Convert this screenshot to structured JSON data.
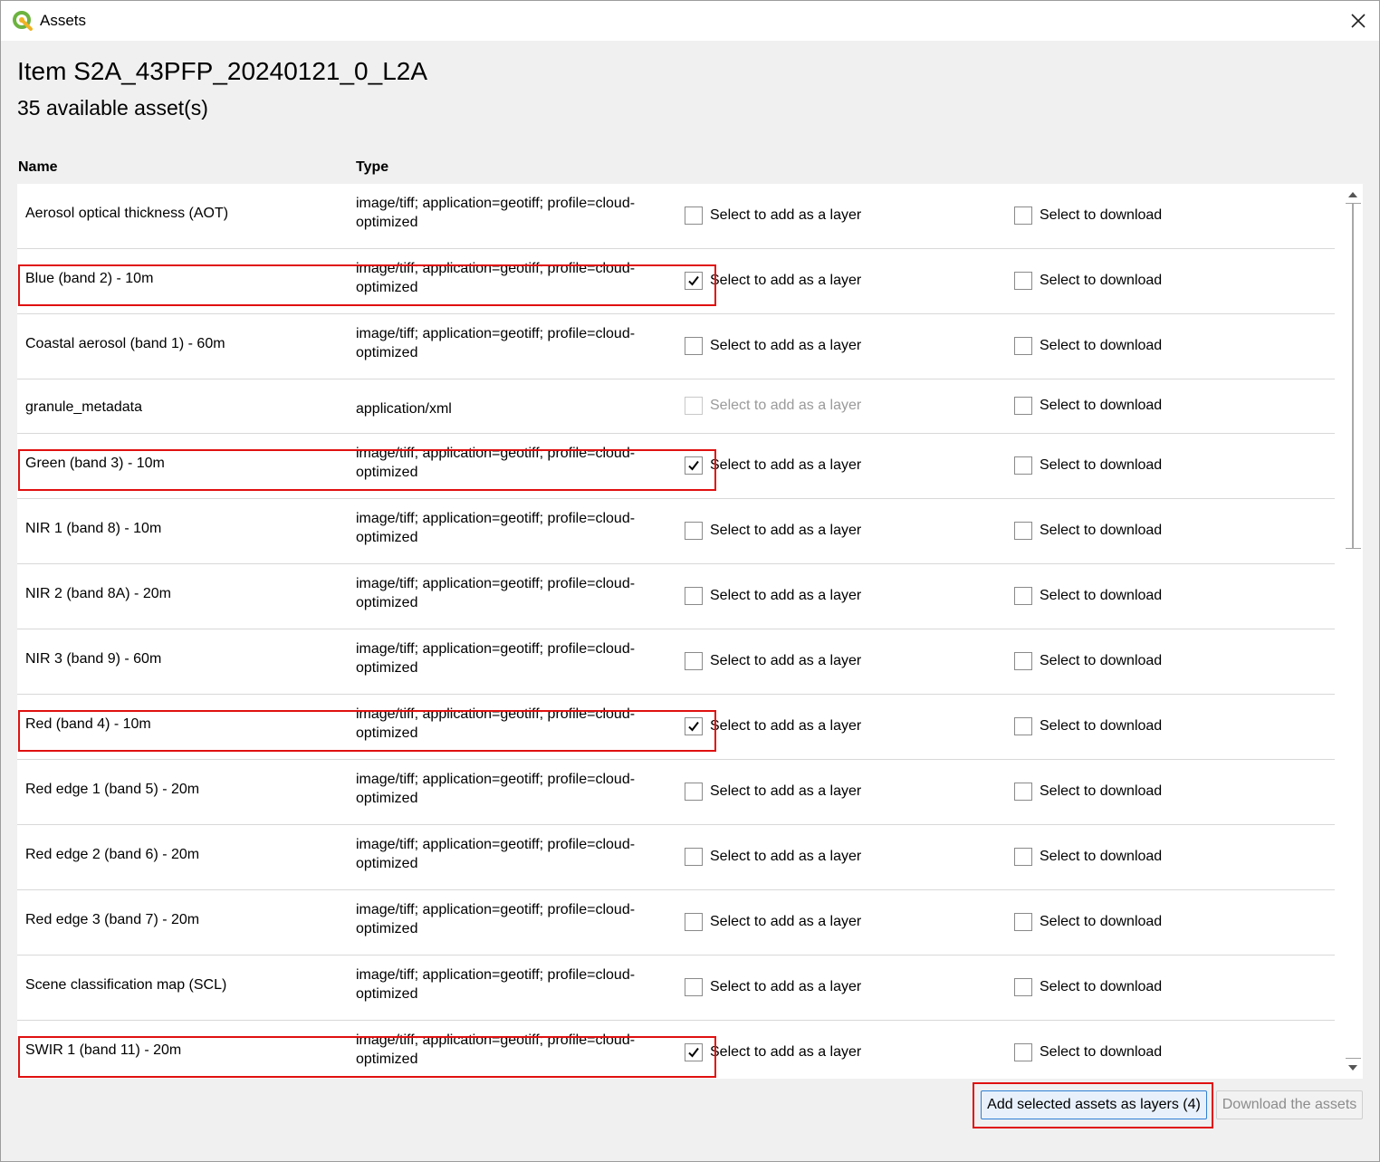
{
  "window": {
    "title": "Assets",
    "icon": "qgis-logo-icon",
    "close_icon": "close-icon"
  },
  "heading": "Item S2A_43PFP_20240121_0_L2A",
  "subheading": "35 available asset(s)",
  "columns": {
    "name": "Name",
    "type": "Type"
  },
  "rows": [
    {
      "name": "Aerosol optical thickness (AOT)",
      "type": "image/tiff; application=geotiff; profile=cloud-optimized",
      "layer_label": "Select to add as a layer",
      "layer_checked": false,
      "layer_enabled": true,
      "download_label": "Select to download",
      "download_checked": false,
      "highlighted": false
    },
    {
      "name": "Blue (band 2) - 10m",
      "type": "image/tiff; application=geotiff; profile=cloud-optimized",
      "layer_label": "Select to add as a layer",
      "layer_checked": true,
      "layer_enabled": true,
      "download_label": "Select to download",
      "download_checked": false,
      "highlighted": true
    },
    {
      "name": "Coastal aerosol (band 1) - 60m",
      "type": "image/tiff; application=geotiff; profile=cloud-optimized",
      "layer_label": "Select to add as a layer",
      "layer_checked": false,
      "layer_enabled": true,
      "download_label": "Select to download",
      "download_checked": false,
      "highlighted": false
    },
    {
      "name": "granule_metadata",
      "type": "application/xml",
      "layer_label": "Select to add as a layer",
      "layer_checked": false,
      "layer_enabled": false,
      "download_label": "Select to download",
      "download_checked": false,
      "highlighted": false
    },
    {
      "name": "Green (band 3) - 10m",
      "type": "image/tiff; application=geotiff; profile=cloud-optimized",
      "layer_label": "Select to add as a layer",
      "layer_checked": true,
      "layer_enabled": true,
      "download_label": "Select to download",
      "download_checked": false,
      "highlighted": true
    },
    {
      "name": "NIR 1 (band 8) - 10m",
      "type": "image/tiff; application=geotiff; profile=cloud-optimized",
      "layer_label": "Select to add as a layer",
      "layer_checked": false,
      "layer_enabled": true,
      "download_label": "Select to download",
      "download_checked": false,
      "highlighted": false
    },
    {
      "name": "NIR 2 (band 8A) - 20m",
      "type": "image/tiff; application=geotiff; profile=cloud-optimized",
      "layer_label": "Select to add as a layer",
      "layer_checked": false,
      "layer_enabled": true,
      "download_label": "Select to download",
      "download_checked": false,
      "highlighted": false
    },
    {
      "name": "NIR 3 (band 9) - 60m",
      "type": "image/tiff; application=geotiff; profile=cloud-optimized",
      "layer_label": "Select to add as a layer",
      "layer_checked": false,
      "layer_enabled": true,
      "download_label": "Select to download",
      "download_checked": false,
      "highlighted": false
    },
    {
      "name": "Red (band 4) - 10m",
      "type": "image/tiff; application=geotiff; profile=cloud-optimized",
      "layer_label": "Select to add as a layer",
      "layer_checked": true,
      "layer_enabled": true,
      "download_label": "Select to download",
      "download_checked": false,
      "highlighted": true
    },
    {
      "name": "Red edge 1 (band 5) - 20m",
      "type": "image/tiff; application=geotiff; profile=cloud-optimized",
      "layer_label": "Select to add as a layer",
      "layer_checked": false,
      "layer_enabled": true,
      "download_label": "Select to download",
      "download_checked": false,
      "highlighted": false
    },
    {
      "name": "Red edge 2 (band 6) - 20m",
      "type": "image/tiff; application=geotiff; profile=cloud-optimized",
      "layer_label": "Select to add as a layer",
      "layer_checked": false,
      "layer_enabled": true,
      "download_label": "Select to download",
      "download_checked": false,
      "highlighted": false
    },
    {
      "name": "Red edge 3 (band 7) - 20m",
      "type": "image/tiff; application=geotiff; profile=cloud-optimized",
      "layer_label": "Select to add as a layer",
      "layer_checked": false,
      "layer_enabled": true,
      "download_label": "Select to download",
      "download_checked": false,
      "highlighted": false
    },
    {
      "name": "Scene classification map (SCL)",
      "type": "image/tiff; application=geotiff; profile=cloud-optimized",
      "layer_label": "Select to add as a layer",
      "layer_checked": false,
      "layer_enabled": true,
      "download_label": "Select to download",
      "download_checked": false,
      "highlighted": false
    },
    {
      "name": "SWIR 1 (band 11) - 20m",
      "type": "image/tiff; application=geotiff; profile=cloud-optimized",
      "layer_label": "Select to add as a layer",
      "layer_checked": true,
      "layer_enabled": true,
      "download_label": "Select to download",
      "download_checked": false,
      "highlighted": true
    }
  ],
  "buttons": {
    "add_layers": "Add selected assets as layers (4)",
    "download": "Download the assets"
  },
  "colors": {
    "highlight": "#e01010",
    "accent": "#2f7fd6"
  }
}
